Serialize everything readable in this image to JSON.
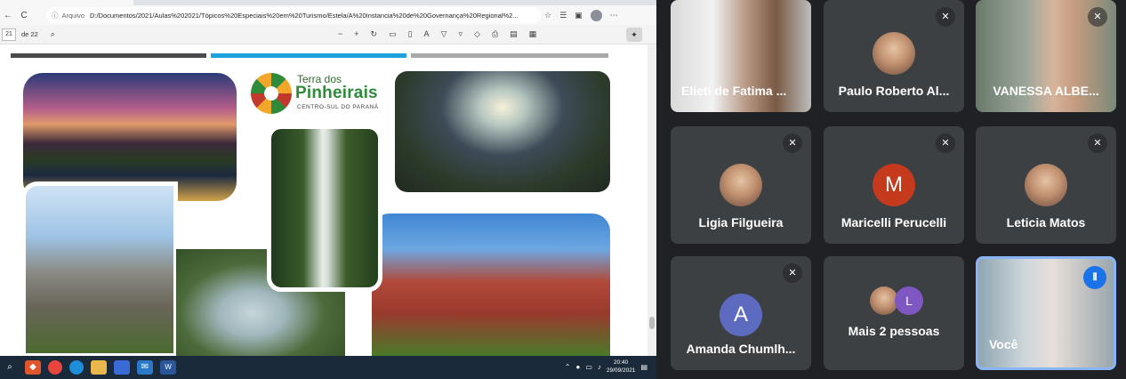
{
  "browser": {
    "addr": {
      "info": "ⓘ",
      "protocol": "Arquivo",
      "url": "D:/Documentos/2021/Aulas%202021/Tópicos%20Especiais%20em%20Turismo/Estela/A%20Instancia%20de%20Governança%20Regional%2..."
    },
    "nav": {
      "back": "←",
      "refresh": "C"
    }
  },
  "pdf": {
    "page_current": "21",
    "page_total": "de 22"
  },
  "logo": {
    "line1": "Terra dos",
    "line2": "Pinheirais",
    "line3": "CENTRO-SUL DO PARANÁ"
  },
  "taskbar": {
    "time": "20:40",
    "date": "29/09/2021"
  },
  "meeting": {
    "participants": [
      {
        "name": "Elieti de Fatima ...",
        "muted": false,
        "type": "video"
      },
      {
        "name": "Paulo Roberto Al...",
        "muted": true,
        "type": "photo"
      },
      {
        "name": "VANESSA ALBE...",
        "muted": true,
        "type": "video"
      },
      {
        "name": "Ligia Filgueira",
        "muted": true,
        "type": "photo"
      },
      {
        "name": "Maricelli Perucelli",
        "muted": true,
        "type": "initial",
        "initial": "M",
        "color": "#c5391d"
      },
      {
        "name": "Leticia Matos",
        "muted": true,
        "type": "photo"
      },
      {
        "name": "Amanda Chumlh...",
        "muted": true,
        "type": "initial",
        "initial": "A",
        "color": "#5c6bc0"
      },
      {
        "name": "Mais 2 pessoas",
        "type": "more",
        "extra_initial": "L",
        "extra_color": "#7e57c2"
      },
      {
        "name": "Você",
        "type": "self",
        "speaking": true
      }
    ]
  },
  "colors": {
    "meet_bg": "#202124",
    "tile_bg": "#3c4043",
    "active_border": "#8ab4f8",
    "speaking": "#1a73e8"
  }
}
